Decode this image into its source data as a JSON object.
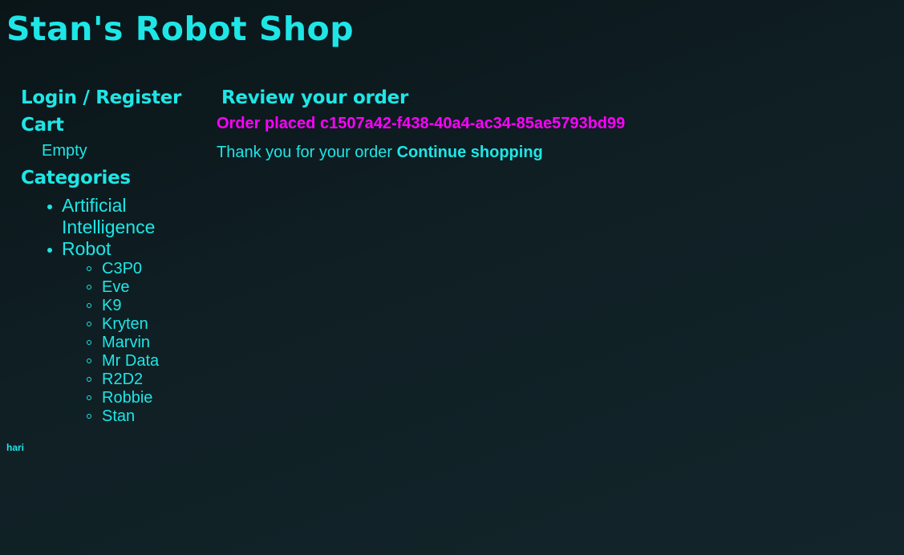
{
  "header": {
    "title": "Stan's Robot Shop"
  },
  "sidebar": {
    "login_label": "Login / Register",
    "cart_heading": "Cart",
    "cart_status": "Empty",
    "categories_heading": "Categories",
    "categories": [
      {
        "label": "Artificial Intelligence",
        "items": []
      },
      {
        "label": "Robot",
        "items": [
          "C3P0",
          "Eve",
          "K9",
          "Kryten",
          "Marvin",
          "Mr Data",
          "R2D2",
          "Robbie",
          "Stan"
        ]
      }
    ]
  },
  "main": {
    "heading": "Review your order",
    "order_placed_prefix": "Order placed",
    "order_id": "c1507a42-f438-40a4-ac34-85ae5793bd99",
    "thanks_text": "Thank you for your order",
    "continue_label": "Continue shopping"
  },
  "footer": {
    "user": "hari"
  },
  "colors": {
    "accent": "#1ee6e6",
    "order_highlight": "#ff00ff",
    "background": "#0f1f24"
  }
}
